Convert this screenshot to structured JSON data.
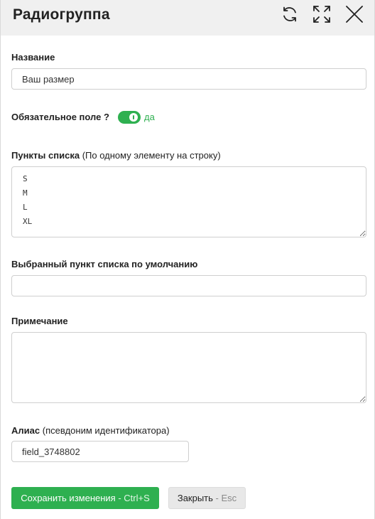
{
  "header": {
    "title": "Радиогруппа"
  },
  "fields": {
    "name": {
      "label": "Название",
      "value": "Ваш размер"
    },
    "required": {
      "label": "Обязательное поле ?",
      "state_label": "да",
      "checked": true
    },
    "items": {
      "label": "Пункты списка",
      "hint": "(По одному элементу на строку)",
      "value": "S\nM\nL\nXL"
    },
    "default_item": {
      "label": "Выбранный пункт списка по умолчанию",
      "value": ""
    },
    "note": {
      "label": "Примечание",
      "value": ""
    },
    "alias": {
      "label": "Алиас",
      "hint": "(псевдоним идентификатора)",
      "value": "field_3748802"
    }
  },
  "footer": {
    "save_label": "Сохранить изменения",
    "save_shortcut": "Ctrl+S",
    "close_label": "Закрыть",
    "close_shortcut": "Esc"
  },
  "colors": {
    "accent": "#2eb050",
    "header_bg": "#f0f0f0"
  },
  "icons": [
    "refresh-icon",
    "expand-icon",
    "close-icon"
  ]
}
